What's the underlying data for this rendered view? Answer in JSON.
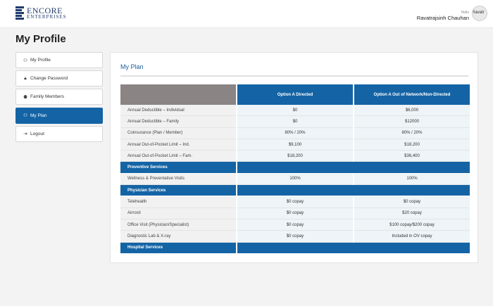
{
  "header": {
    "logo_line1": "ENCORE",
    "logo_line2": "ENTERPRISES",
    "greeting": "Hello",
    "user_name": "Ravatrajsinh Chauhan",
    "avatar_label": "Ravatr"
  },
  "page_title": "My Profile",
  "menu": [
    {
      "label": "My Profile",
      "icon": "user-icon"
    },
    {
      "label": "Change Password",
      "icon": "lock-icon"
    },
    {
      "label": "Family Members",
      "icon": "family-icon"
    },
    {
      "label": "My Plan",
      "icon": "user-icon",
      "active": true
    },
    {
      "label": "Logout",
      "icon": "logout-icon"
    }
  ],
  "card_title": "My Plan",
  "table": {
    "headers": [
      "",
      "Option A Directed",
      "Option A Out of Network/Non-Directed"
    ],
    "rows": [
      {
        "type": "row",
        "label": "Annual Deductible – Individual",
        "a": "$0",
        "b": "$6,000"
      },
      {
        "type": "row",
        "label": "Annual Deductible – Family",
        "a": "$0",
        "b": "$12000"
      },
      {
        "type": "row",
        "label": "Coinsurance (Plan / Member)",
        "a": "80% / 20%",
        "b": "80% / 20%"
      },
      {
        "type": "row",
        "label": "Annual Out-of-Pocket Limit – Ind.",
        "a": "$9,100",
        "b": "$18,200"
      },
      {
        "type": "row",
        "label": "Annual Out-of-Pocket Limit – Fam.",
        "a": "$18,200",
        "b": "$36,400"
      },
      {
        "type": "section",
        "label": "Preventive Services"
      },
      {
        "type": "row",
        "label": "Wellness & Preventative Visits",
        "a": "100%",
        "b": "100%"
      },
      {
        "type": "section",
        "label": "Physician Services"
      },
      {
        "type": "row",
        "label": "Telehealth",
        "a": "$0 copay",
        "b": "$0 copay"
      },
      {
        "type": "row",
        "label": "Airrosti",
        "a": "$0 copay",
        "b": "$20 copay"
      },
      {
        "type": "row",
        "label": "Office Visit (Physician/Specialist)",
        "a": "$0 copay",
        "b": "$100 copay/$200 copay"
      },
      {
        "type": "row",
        "label": "Diagnostic Lab & X-ray",
        "a": "$0 copay",
        "b": "Included in OV copay"
      },
      {
        "type": "section",
        "label": "Hospital Services"
      }
    ]
  },
  "colors": {
    "primary": "#1464a5",
    "header_blank": "#8a8584",
    "logo": "#1f3b6e"
  }
}
